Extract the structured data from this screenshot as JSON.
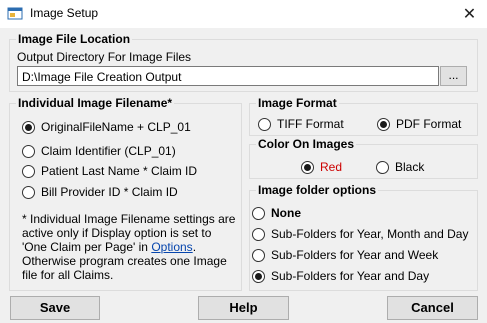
{
  "window": {
    "title": "Image Setup",
    "close_glyph": "✕",
    "icon": "app-window-icon"
  },
  "image_file_location": {
    "group_title": "Image File Location",
    "output_dir_label": "Output Directory For Image Files",
    "output_dir_value": "D:\\Image File Creation Output",
    "browse_label": "..."
  },
  "filename": {
    "group_title": "Individual Image Filename*",
    "options": [
      {
        "label": "OriginalFileName + CLP_01",
        "checked": true
      },
      {
        "label": "Claim Identifier (CLP_01)",
        "checked": false
      },
      {
        "label": "Patient Last Name * Claim ID",
        "checked": false
      },
      {
        "label": "Bill Provider ID * Claim ID",
        "checked": false
      }
    ],
    "note_part1": "* Individual Image Filename settings are active only if Display option is set to 'One Claim per Page' in",
    "note_link": "Options",
    "note_part2": ". Otherwise program creates one Image file for all Claims."
  },
  "image_format": {
    "group_title": "Image Format",
    "options": [
      {
        "label": "TIFF Format",
        "checked": false
      },
      {
        "label": "PDF Format",
        "checked": true
      }
    ]
  },
  "color": {
    "group_title": "Color On Images",
    "options": [
      {
        "label": "Red",
        "checked": true
      },
      {
        "label": "Black",
        "checked": false
      }
    ],
    "colors": {
      "red": "#cc0000"
    }
  },
  "folder_options": {
    "group_title": "Image folder options",
    "options": [
      {
        "label": "None",
        "checked": false,
        "bold": true
      },
      {
        "label": "Sub-Folders for Year, Month and Day",
        "checked": false
      },
      {
        "label": "Sub-Folders for Year and Week",
        "checked": false
      },
      {
        "label": "Sub-Folders for Year and Day",
        "checked": true
      }
    ]
  },
  "buttons": {
    "save": "Save",
    "help": "Help",
    "cancel": "Cancel"
  }
}
